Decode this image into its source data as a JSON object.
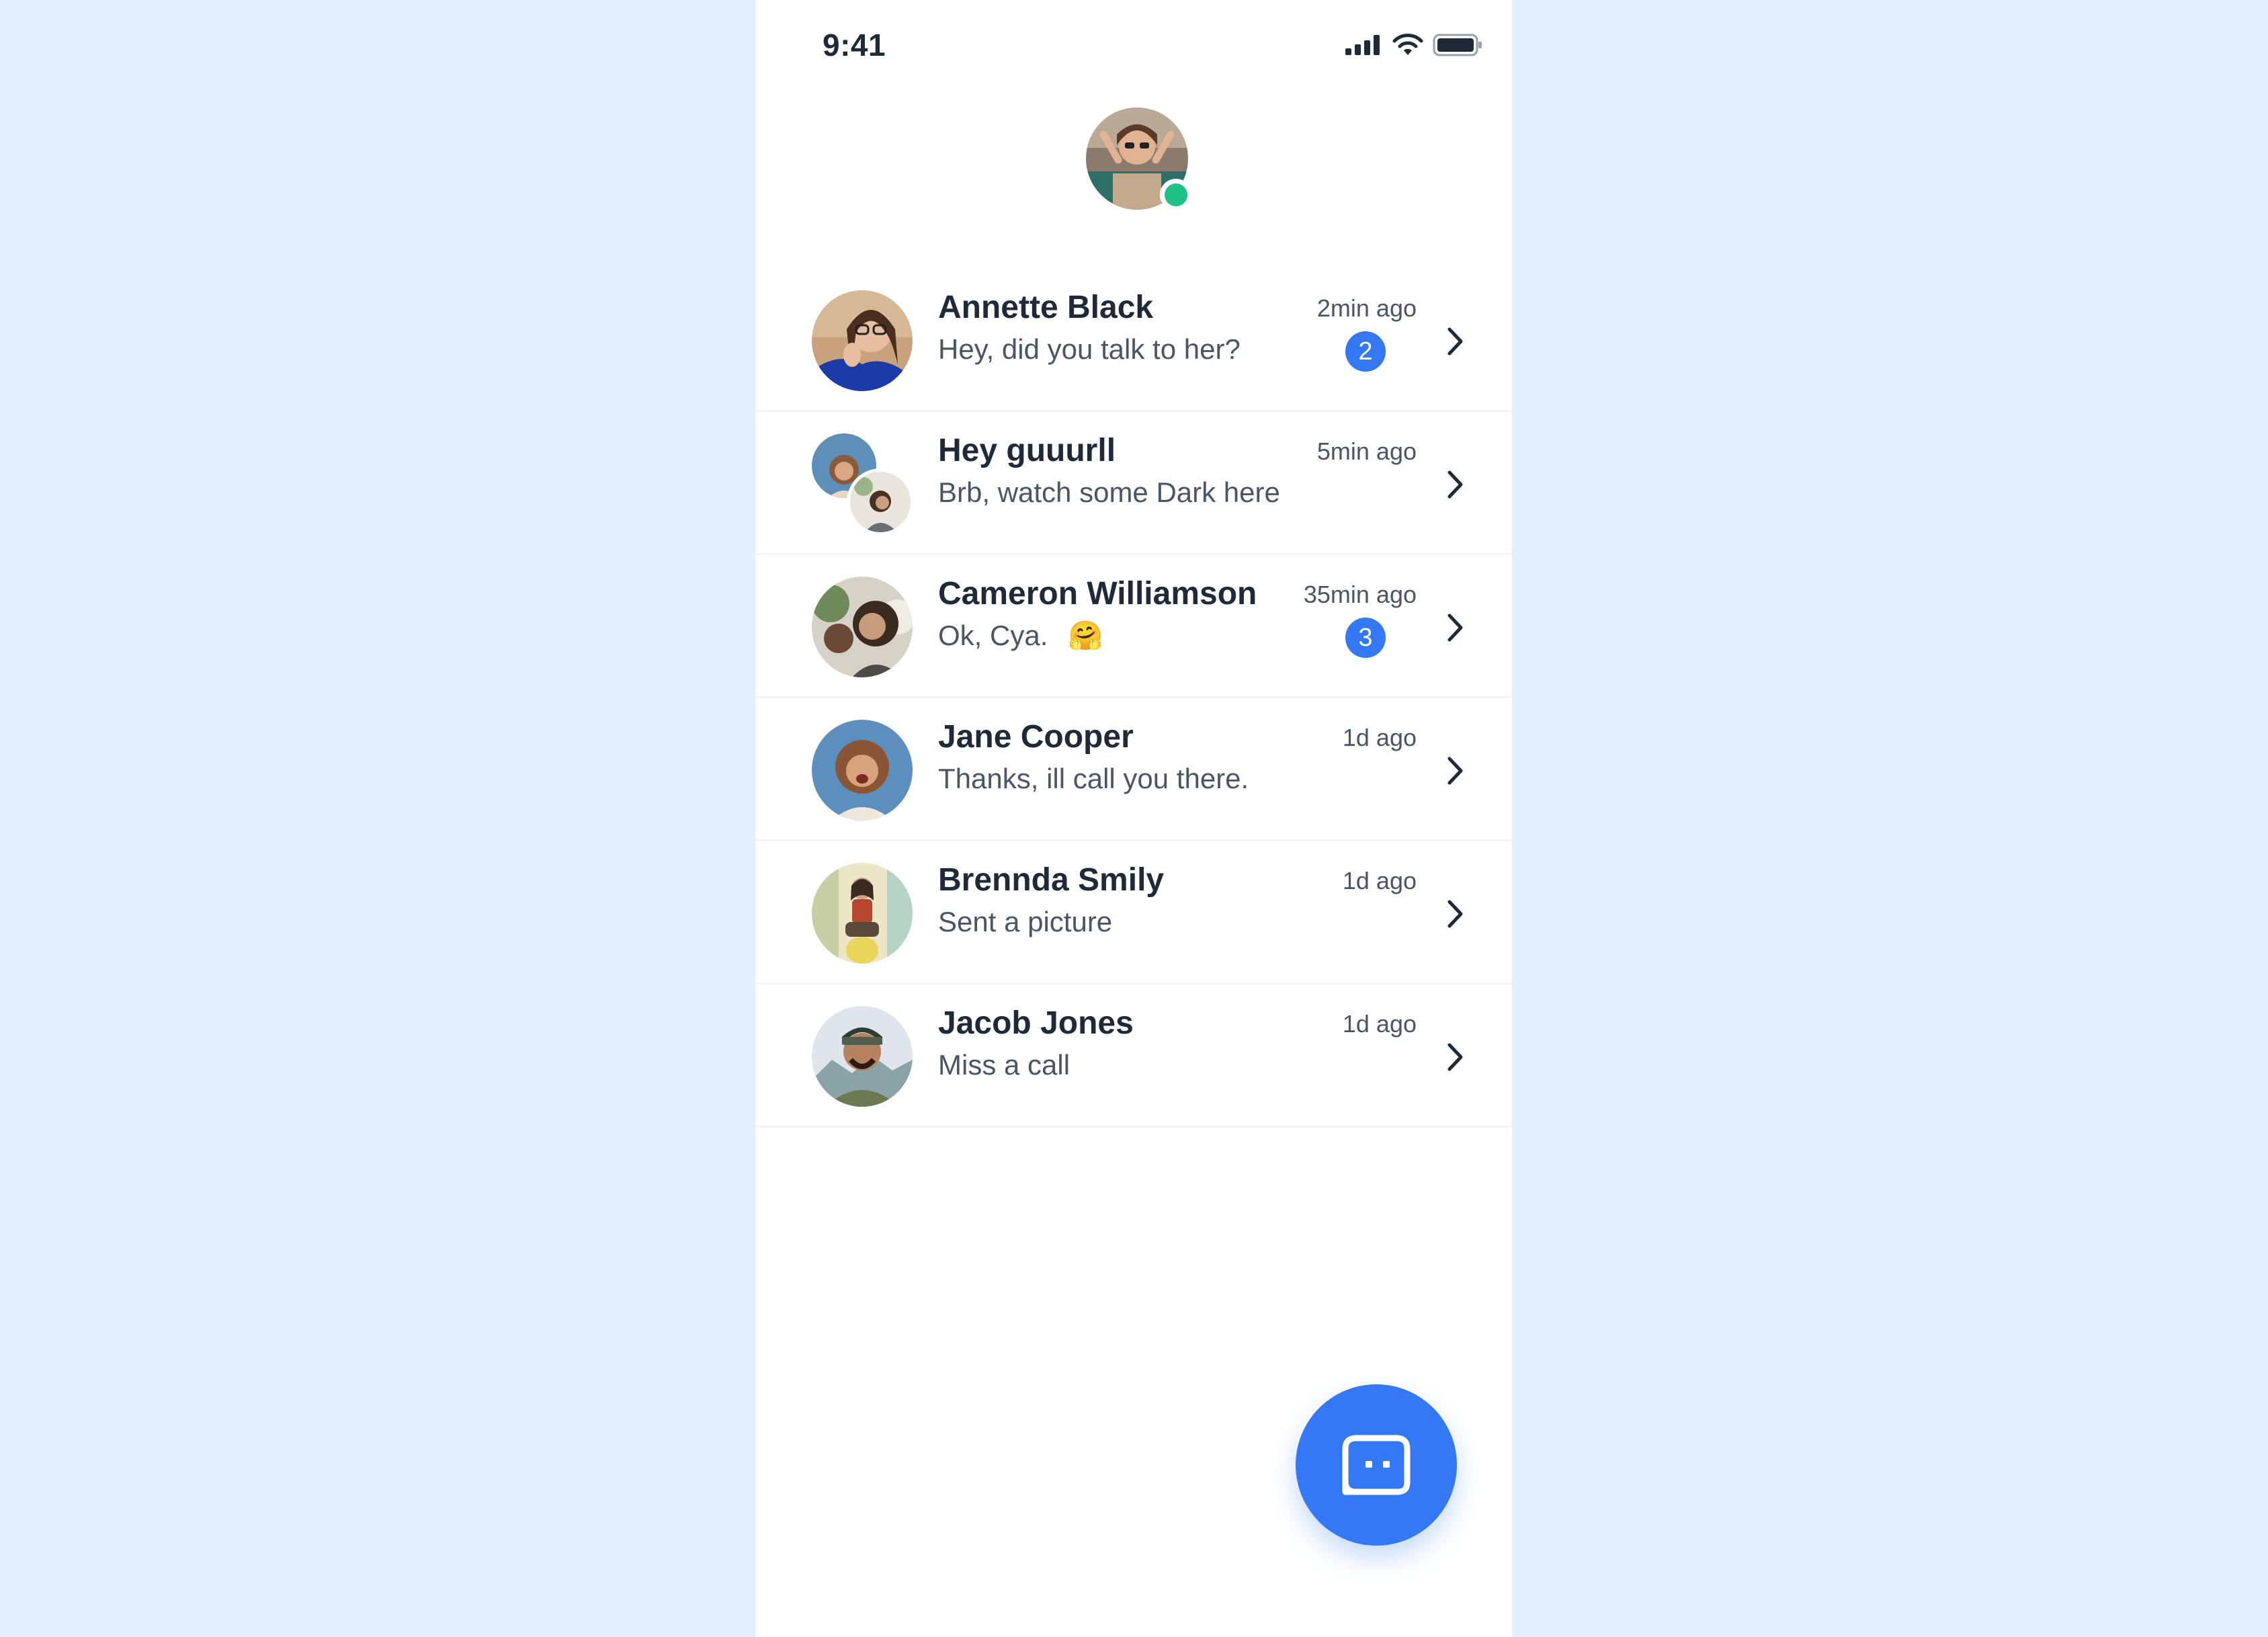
{
  "status_bar": {
    "time": "9:41"
  },
  "profile": {
    "online": true
  },
  "conversations": [
    {
      "name": "Annette Black",
      "message": "Hey, did you talk to her?",
      "time": "2min ago",
      "unread": "2",
      "avatar": "woman-glasses"
    },
    {
      "name": "Hey guuurll",
      "message": "Brb, watch some Dark here",
      "time": "5min ago",
      "unread": "",
      "avatar": "group"
    },
    {
      "name": "Cameron Williamson",
      "message": "Ok, Cya.",
      "emoji": "🤗",
      "time": "35min ago",
      "unread": "3",
      "avatar": "woman-outdoor"
    },
    {
      "name": "Jane Cooper",
      "message": "Thanks, ill call you there.",
      "time": "1d ago",
      "unread": "",
      "avatar": "woman-curly"
    },
    {
      "name": "Brennda Smily",
      "message": "Sent a picture",
      "time": "1d ago",
      "unread": "",
      "avatar": "woman-sitting"
    },
    {
      "name": "Jacob Jones",
      "message": "Miss a call",
      "time": "1d ago",
      "unread": "",
      "avatar": "man-beanie"
    }
  ],
  "icons": {
    "signal": "signal-icon",
    "wifi": "wifi-icon",
    "battery": "battery-icon",
    "chevron": "chevron-right-icon",
    "new_chat": "chat-bubble-icon"
  },
  "colors": {
    "accent": "#3478f6",
    "online": "#1fc187",
    "background": "#e3effd"
  }
}
